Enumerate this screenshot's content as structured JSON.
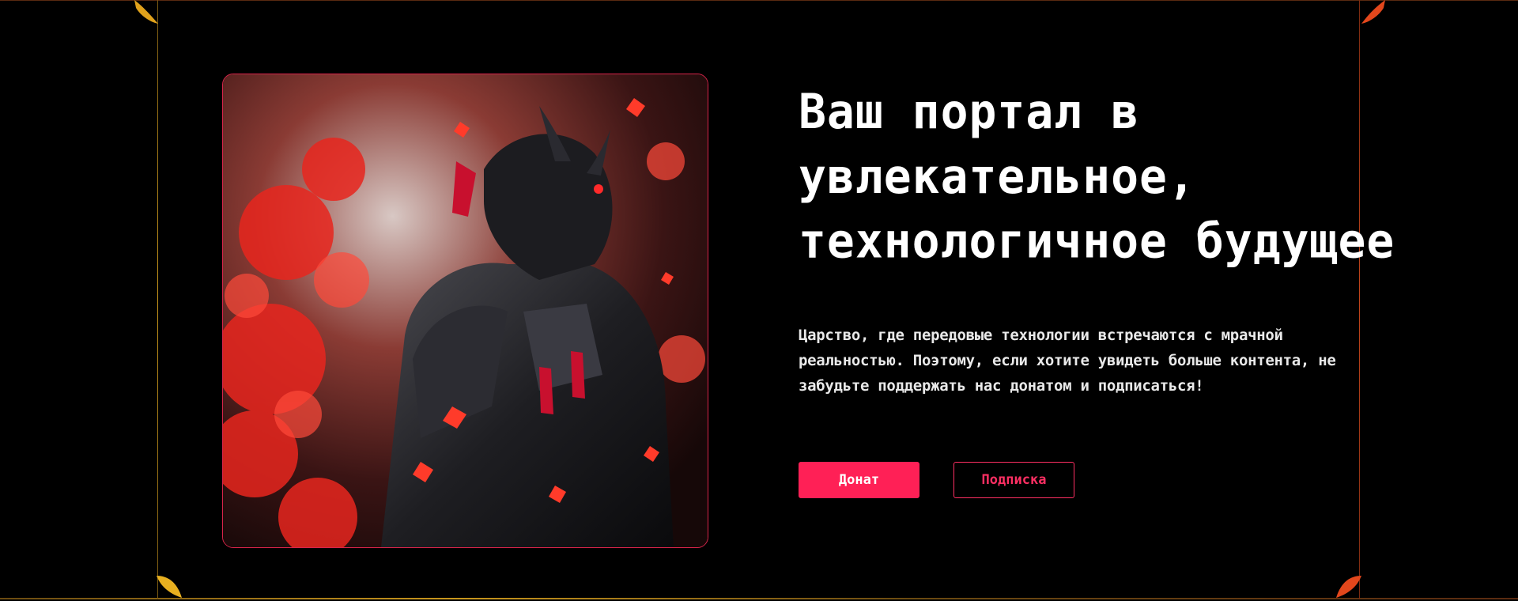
{
  "hero": {
    "headline_lines": [
      "Ваш портал в",
      "увлекательное,",
      "технологичное будущее"
    ],
    "lead_lines": [
      "Царство, где передовые технологии встречаются с мрачной",
      "реальностью. Поэтому, если хотите увидеть больше контента, не",
      "забудьте поддержать нас донатом и подписаться!"
    ],
    "image_icon": "samurai-artwork",
    "donate_label": "Донат",
    "subscribe_label": "Подписка"
  },
  "colors": {
    "background": "#000000",
    "accent": "#ff2056",
    "frame_gold": "#c8961c",
    "frame_red": "#c0441a"
  }
}
